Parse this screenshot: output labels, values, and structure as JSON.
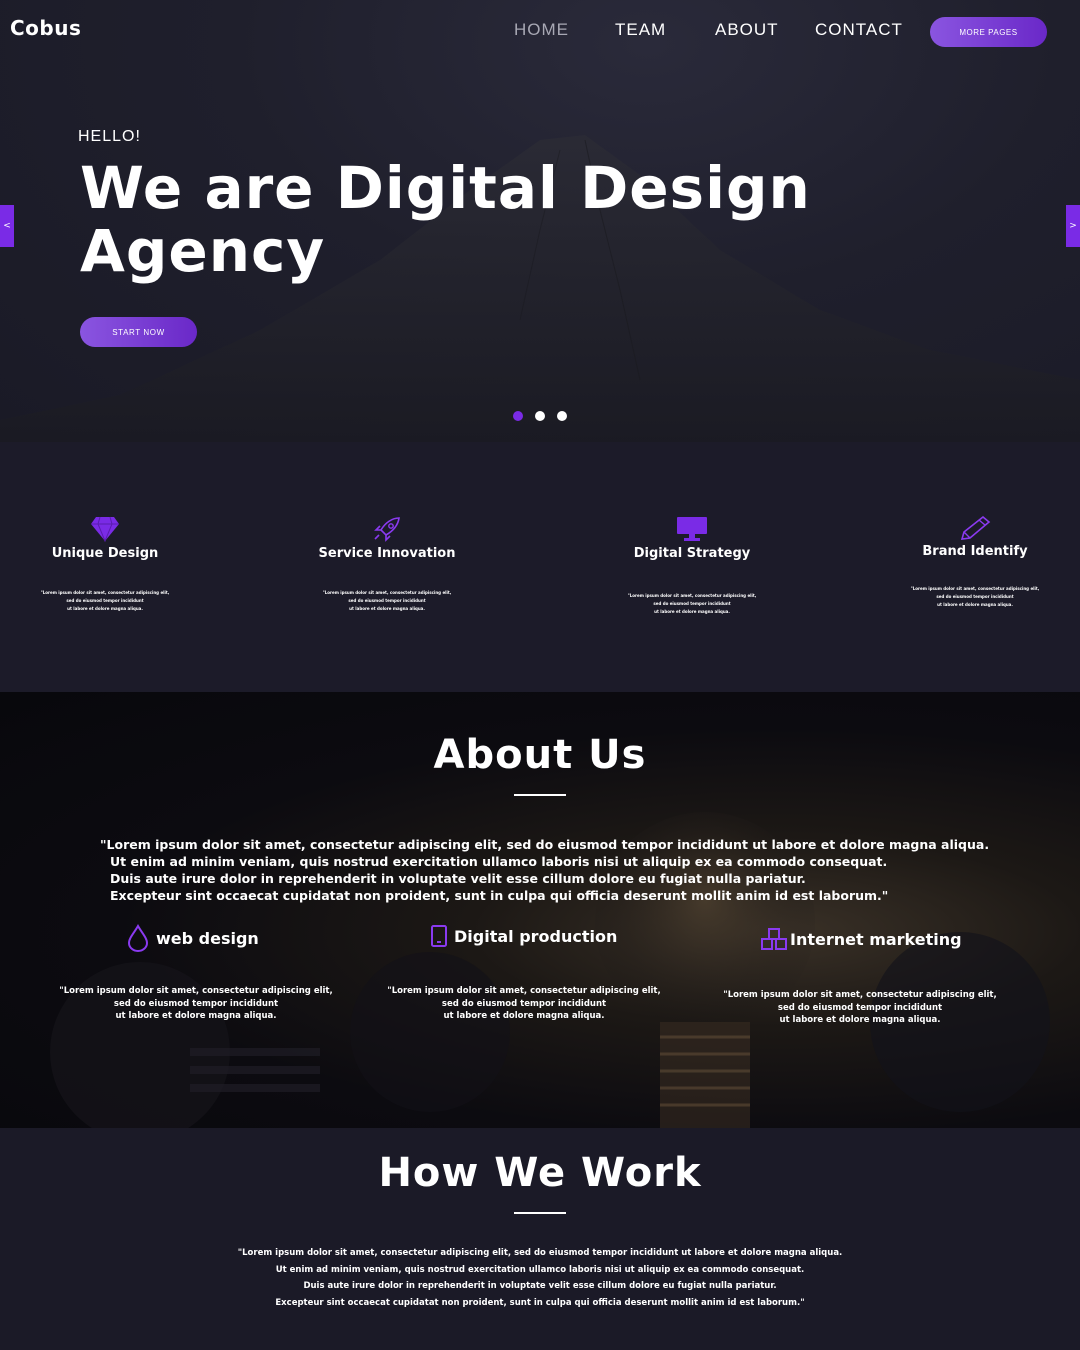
{
  "header": {
    "brand": "Cobus",
    "nav": [
      "HOME",
      "TEAM",
      "ABOUT",
      "CONTACT"
    ],
    "more_pages": "MORE PAGES"
  },
  "hero": {
    "eyebrow": "HELLO!",
    "headline_line1": "We are Digital Design",
    "headline_line2": "Agency",
    "cta": "START NOW",
    "prev_arrow": "<",
    "next_arrow": ">",
    "slides": {
      "count": 3,
      "active": 1
    }
  },
  "features": [
    {
      "title": "Unique Design",
      "icon": "diamond-icon",
      "text": [
        "\"Lorem ipsum dolor sit amet, consectetur adipiscing elit,",
        "sed do eiusmod tempor incididunt",
        "ut labore et dolore magna aliqua."
      ]
    },
    {
      "title": "Service Innovation",
      "icon": "rocket-icon",
      "text": [
        "\"Lorem ipsum dolor sit amet, consectetur adipiscing elit,",
        "sed do eiusmod tempor incididunt",
        "ut labore et dolore magna aliqua."
      ]
    },
    {
      "title": "Digital Strategy",
      "icon": "monitor-icon",
      "text": [
        "\"Lorem ipsum dolor sit amet, consectetur adipiscing elit,",
        "sed do eiusmod tempor incididunt",
        "ut labore et dolore magna aliqua."
      ]
    },
    {
      "title": "Brand Identify",
      "icon": "pencil-icon",
      "text": [
        "\"Lorem ipsum dolor sit amet, consectetur adipiscing elit,",
        "sed do eiusmod tempor incididunt",
        "ut labore et dolore magna aliqua."
      ]
    }
  ],
  "about": {
    "title": "About Us",
    "lead": [
      "\"Lorem ipsum dolor sit amet, consectetur adipiscing elit, sed do eiusmod tempor incididunt ut labore et dolore magna aliqua.",
      "Ut enim ad minim veniam, quis nostrud exercitation ullamco laboris nisi ut aliquip ex ea commodo consequat.",
      "Duis aute irure dolor in reprehenderit in voluptate velit esse cillum dolore eu fugiat nulla pariatur.",
      "Excepteur sint occaecat cupidatat non proident, sunt in culpa qui officia deserunt mollit anim id est laborum.\""
    ],
    "services": [
      {
        "title": "web design",
        "icon": "drop-icon",
        "text": [
          "\"Lorem ipsum dolor sit amet, consectetur adipiscing elit,",
          "sed do eiusmod tempor incididunt",
          "ut labore et dolore magna aliqua."
        ]
      },
      {
        "title": "Digital production",
        "icon": "tablet-icon",
        "text": [
          "\"Lorem ipsum dolor sit amet, consectetur adipiscing elit,",
          "sed do eiusmod tempor incididunt",
          "ut labore et dolore magna aliqua."
        ]
      },
      {
        "title": "Internet marketing",
        "icon": "cubes-icon",
        "text": [
          "\"Lorem ipsum dolor sit amet, consectetur adipiscing elit,",
          "sed do eiusmod tempor incididunt",
          "ut labore et dolore magna aliqua."
        ]
      }
    ]
  },
  "work": {
    "title": "How We Work",
    "body": [
      "\"Lorem ipsum dolor sit amet, consectetur adipiscing elit, sed do eiusmod tempor incididunt ut labore et dolore magna aliqua.",
      "Ut enim ad minim veniam, quis nostrud exercitation ullamco laboris nisi ut aliquip ex ea commodo consequat.",
      "Duis aute irure dolor in reprehenderit in voluptate velit esse cillum dolore eu fugiat nulla pariatur.",
      "Excepteur sint occaecat cupidatat non proident, sunt in culpa qui officia deserunt mollit anim id est laborum.\""
    ]
  },
  "colors": {
    "accent": "#7a2be6",
    "accent_light": "#8a55e0",
    "bg": "#1b1a27"
  }
}
